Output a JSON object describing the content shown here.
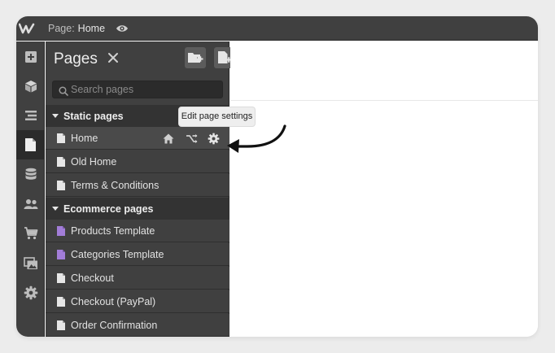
{
  "topbar": {
    "page_prefix": "Page:",
    "page_name": "Home"
  },
  "pages_panel": {
    "title": "Pages",
    "search": {
      "placeholder": "Search pages",
      "value": ""
    },
    "static_section": "Static pages",
    "static_pages": [
      "Home",
      "Old Home",
      "Terms & Conditions"
    ],
    "ecommerce_section": "Ecommerce pages",
    "ecommerce_pages": [
      "Products Template",
      "Categories Template",
      "Checkout",
      "Checkout (PayPal)",
      "Order Confirmation"
    ]
  },
  "tooltip": "Edit page settings",
  "colors": {
    "template_page_icon": "#a27dd8",
    "page_icon": "#e6e6e6"
  },
  "icons": [
    "webflow-logo-icon",
    "eye-icon",
    "add-icon",
    "cube-icon",
    "navigator-icon",
    "pages-icon",
    "cms-icon",
    "users-icon",
    "cart-icon",
    "assets-icon",
    "settings-icon",
    "new-folder-icon",
    "new-page-icon",
    "close-icon",
    "search-icon",
    "home-icon",
    "branch-icon",
    "gear-icon",
    "annotation-arrow-icon"
  ]
}
